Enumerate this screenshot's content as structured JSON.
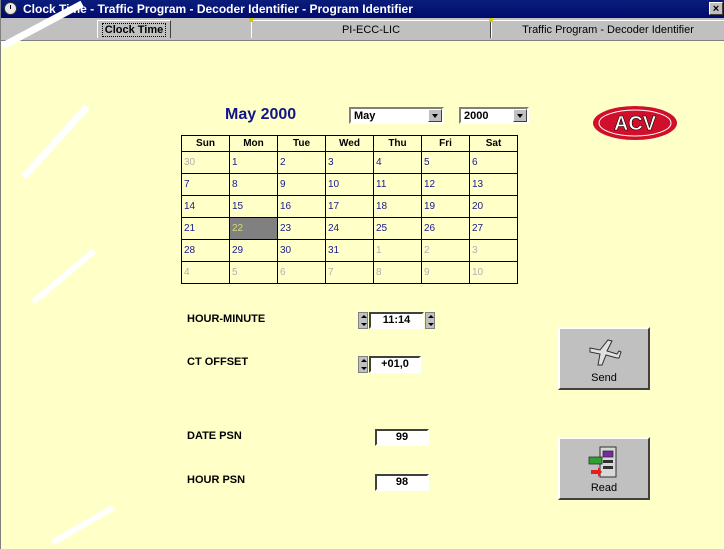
{
  "window": {
    "title": "Clock Time - Traffic Program - Decoder Identifier - Program Identifier",
    "close_label": "×"
  },
  "tabs": [
    {
      "label": "Clock Time",
      "active": true
    },
    {
      "label": "PI-ECC-LIC",
      "active": false
    },
    {
      "label": "Traffic Program - Decoder Identifier",
      "active": false
    }
  ],
  "calendar": {
    "title": "May 2000",
    "month_select": "May",
    "year_select": "2000",
    "weekdays": [
      "Sun",
      "Mon",
      "Tue",
      "Wed",
      "Thu",
      "Fri",
      "Sat"
    ],
    "weeks": [
      [
        "30",
        "1",
        "2",
        "3",
        "4",
        "5",
        "6"
      ],
      [
        "7",
        "8",
        "9",
        "10",
        "11",
        "12",
        "13"
      ],
      [
        "14",
        "15",
        "16",
        "17",
        "18",
        "19",
        "20"
      ],
      [
        "21",
        "22",
        "23",
        "24",
        "25",
        "26",
        "27"
      ],
      [
        "28",
        "29",
        "30",
        "31",
        "1",
        "2",
        "3"
      ],
      [
        "4",
        "5",
        "6",
        "7",
        "8",
        "9",
        "10"
      ]
    ],
    "selected_day": "22"
  },
  "logo_text": "ACV",
  "hour_minute": {
    "label": "HOUR-MINUTE",
    "value": "11:14"
  },
  "ct_offset": {
    "label": "CT OFFSET",
    "value": "+01,0"
  },
  "date_psn": {
    "label": "DATE PSN",
    "value": "99"
  },
  "hour_psn": {
    "label": "HOUR PSN",
    "value": "98"
  },
  "send_button": {
    "label": "Send",
    "icon": "airplane-icon"
  },
  "read_button": {
    "label": "Read",
    "icon": "card-reader-icon"
  },
  "colors": {
    "background": "#ffffc8",
    "titlebar": "#000a6e",
    "accent_blue": "#12148a",
    "logo_red": "#d0102a"
  }
}
